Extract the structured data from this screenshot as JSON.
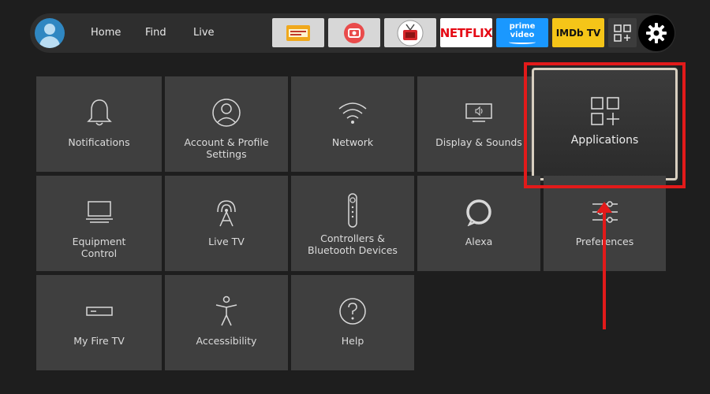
{
  "navbar": {
    "links": [
      "Home",
      "Find",
      "Live"
    ],
    "apps": [
      {
        "name": "cinema-hd-app",
        "bg": "#d7d7d7"
      },
      {
        "name": "screen-recorder-app",
        "bg": "#d7d7d7"
      },
      {
        "name": "red-tv-app",
        "bg": "#d7d7d7"
      },
      {
        "name": "netflix-app",
        "label": "NETFLIX",
        "bg": "#ffffff"
      },
      {
        "name": "prime-video-app",
        "label": "prime video",
        "bg": "#1a98ff"
      },
      {
        "name": "imdb-tv-app",
        "label": "IMDb TV",
        "bg": "#f5c518"
      }
    ]
  },
  "settings": {
    "tiles": [
      {
        "label": "Notifications",
        "icon": "bell-icon"
      },
      {
        "label": "Account & Profile Settings",
        "icon": "profile-icon"
      },
      {
        "label": "Network",
        "icon": "wifi-icon"
      },
      {
        "label": "Display & Sounds",
        "icon": "display-sound-icon"
      },
      {
        "label": "Applications",
        "icon": "applications-icon"
      },
      {
        "label": "Equipment Control",
        "icon": "equipment-tv-icon"
      },
      {
        "label": "Live TV",
        "icon": "antenna-icon"
      },
      {
        "label": "Controllers & Bluetooth Devices",
        "icon": "remote-icon"
      },
      {
        "label": "Alexa",
        "icon": "alexa-icon"
      },
      {
        "label": "Preferences",
        "icon": "sliders-icon"
      },
      {
        "label": "My Fire TV",
        "icon": "fire-tv-device-icon"
      },
      {
        "label": "Accessibility",
        "icon": "accessibility-icon"
      },
      {
        "label": "Help",
        "icon": "help-icon"
      }
    ]
  },
  "colors": {
    "annotation": "#e21a1a",
    "tile_bg": "#3f3f3f",
    "background": "#1e1e1e"
  }
}
